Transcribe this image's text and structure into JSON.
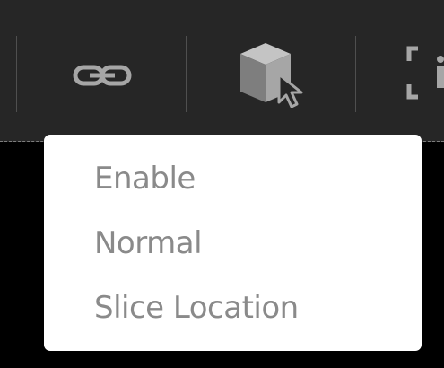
{
  "toolbar": {
    "buttons": [
      {
        "name": "link-tool",
        "icon": "link-icon"
      },
      {
        "name": "3d-cube-select-tool",
        "icon": "cube-cursor-icon"
      },
      {
        "name": "info-frame-tool",
        "icon": "info-frame-icon"
      }
    ]
  },
  "menu": {
    "items": [
      {
        "label": "Enable"
      },
      {
        "label": "Normal"
      },
      {
        "label": "Slice Location"
      }
    ]
  },
  "colors": {
    "toolbar_background": "#262626",
    "page_background": "#000000",
    "menu_background": "#ffffff",
    "menu_text": "#8a8a8a",
    "icon_fill": "#a6a6a6"
  }
}
